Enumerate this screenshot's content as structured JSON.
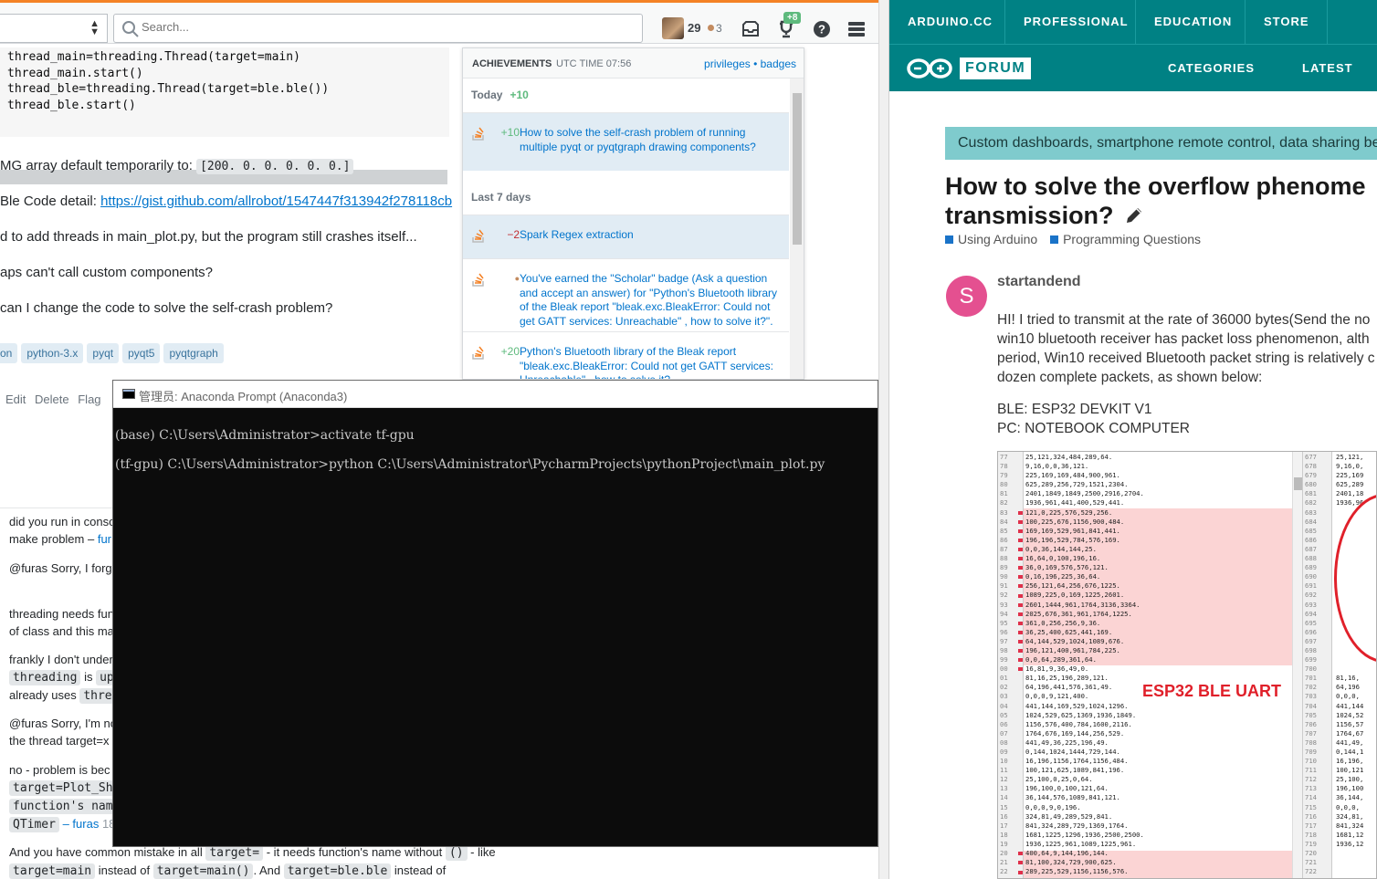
{
  "so": {
    "search_placeholder": "Search...",
    "reputation": "29",
    "bronze_count": "3",
    "achievements_badge": "+8",
    "code_lines": "thread_main=threading.Thread(target=main)\nthread_main.start()\nthread_ble=threading.Thread(target=ble.ble())\nthread_ble.start()",
    "question": {
      "line1_text": "MG array default temporarily to: ",
      "line1_code": "[200.    0.    0.    0.    0.    0.]",
      "line2_text": " Ble Code detail: ",
      "line2_link": "https://gist.github.com/allrobot/1547447f313942f278118cb",
      "line3": "d to add threads in main_plot.py, but the program still crashes itself...",
      "line4": "aps can't call custom components?",
      "line5": "can I change the code to solve the self-crash problem?"
    },
    "tags": [
      "on",
      "python-3.x",
      "pyqt",
      "pyqt5",
      "pyqtgraph"
    ],
    "post_menu": [
      "Edit",
      "Delete",
      "Flag"
    ],
    "achievements": {
      "title": "ACHIEVEMENTS",
      "utc": "UTC TIME 07:56",
      "link_privileges": "privileges",
      "link_sep": " • ",
      "link_badges": "badges",
      "today_label": "Today",
      "today_total": "+10",
      "last7_label": "Last 7 days",
      "items": [
        {
          "delta": "+10",
          "text": "How to solve the self-crash problem of running multiple pyqt or pyqtgraph drawing components?"
        },
        {
          "delta": "−2",
          "text": "Spark Regex extraction"
        },
        {
          "delta": "●",
          "text": "You've earned the \"Scholar\" badge (Ask a question and accept an answer) for \"Python's Bluetooth library of the Bleak report \"bleak.exc.BleakError: Could not get GATT services: Unreachable\" , how to solve it?\"."
        },
        {
          "delta": "+20",
          "text": "Python's Bluetooth library of the Bleak report \"bleak.exc.BleakError: Could not get GATT services: Unreachable\" , how to solve it?"
        }
      ]
    },
    "comments": {
      "c1a": "did you run in conso",
      "c1b": "make problem – ",
      "c1b_user": "fur",
      "c2": "@furas Sorry, I forg",
      "c3a": "threading needs fun",
      "c3b": "of class and this ma",
      "c4a": "frankly I don't under",
      "c4b_code": "threading",
      "c4b_text": " is ",
      "c4b_code2": "up",
      "c4c_text": "already uses ",
      "c4c_code": "threa",
      "c5a": "@furas Sorry, I'm no",
      "c5b": "the thread target=x",
      "c6a": "no - problem is bec",
      "c6b_code": "target=Plot_Sh",
      "c6c_code": "function's nam",
      "c6d_code": "QTimer",
      "c6d_user": " – furas",
      "c6d_time": " 18",
      "bottom_1": "And you have common mistake in all ",
      "bottom_code1": "target=",
      "bottom_2": " - it needs function's name without ",
      "bottom_code2": "()",
      "bottom_3": " - like",
      "bottom_code3": "target=main",
      "bottom_4": " instead of ",
      "bottom_code4": "target=main()",
      "bottom_5": ". And ",
      "bottom_code5": "target=ble.ble",
      "bottom_6": " instead of"
    }
  },
  "console": {
    "title": "管理员: Anaconda Prompt (Anaconda3)",
    "lines": "(base) C:\\Users\\Administrator>activate tf-gpu\n(tf-gpu) C:\\Users\\Administrator>python C:\\Users\\Administrator\\PycharmProjects\\pythonProject\\main_plot.py"
  },
  "arduino": {
    "nav1": [
      "ARDUINO.CC",
      "PROFESSIONAL",
      "EDUCATION",
      "STORE"
    ],
    "forum_label": "FORUM",
    "nav2": [
      "CATEGORIES",
      "LATEST"
    ],
    "banner": "Custom dashboards, smartphone remote control, data sharing be",
    "title_line1": "How to solve the overflow phenome",
    "title_line2": "transmission?",
    "edit_icon": "pencil-icon",
    "category1": "Using Arduino",
    "category2": "Programming Questions",
    "author_initial": "S",
    "author": "startandend",
    "body": [
      "HI! I tried to transmit at the rate of 36000 bytes(Send the no",
      "win10 bluetooth receiver has packet loss phenomenon, alth",
      "period, Win10 received Bluetooth packet string is relatively c",
      "dozen complete packets, as shown below:"
    ],
    "spec1": "BLE: ESP32 DEVKIT V1",
    "spec2": "PC: NOTEBOOK COMPUTER",
    "image_label": "ESP32 BLE UART",
    "left_line_numbers": "77\n78\n79\n80\n81\n82\n83\n84\n85\n86\n87\n88\n89\n90\n91\n92\n93\n94\n95\n96\n97\n98\n99\n00\n01\n02\n03\n04\n05\n06\n07\n08\n09\n10\n11\n12\n13\n14\n15\n16\n17\n18\n19\n20\n21\n22",
    "left_text": "25,121,324,484,289,64.\n9,16,0,0,36,121.\n225,169,169,484,900,961.\n625,289,256,729,1521,2304.\n2401,1849,1849,2500,2916,2704.\n1936,961,441,400,529,441.\n121,0,225,576,529,256.\n100,225,676,1156,900,484.\n169,169,529,961,841,441.\n196,196,529,784,576,169.\n0,0,36,144,144,25.\n16,64,0,100,196,16.\n36,0,169,576,576,121.\n0,16,196,225,36,64.\n256,121,64,256,676,1225.\n1089,225,0,169,1225,2601.\n2601,1444,961,1764,3136,3364.\n2025,676,361,961,1764,1225.\n361,0,256,256,9,36.\n36,25,400,625,441,169.\n64,144,529,1024,1089,676.\n196,121,400,961,784,225.\n0,0,64,289,361,64.\n16,81,9,36,49,0.\n81,16,25,196,289,121.\n64,196,441,576,361,49.\n0,0,0,9,121,400.\n441,144,169,529,1024,1296.\n1024,529,625,1369,1936,1849.\n1156,576,400,784,1600,2116.\n1764,676,169,144,256,529.\n441,49,36,225,196,49.\n0,144,1024,1444,729,144.\n16,196,1156,1764,1156,484.\n100,121,625,1089,841,196.\n25,100,0,25,0,64.\n196,100,0,100,121,64.\n36,144,576,1089,841,121.\n0,0,0,9,0,196.\n324,81,49,289,529,841.\n841,324,289,729,1369,1764.\n1681,1225,1296,1936,2500,2500.\n1936,1225,961,1089,1225,961.\n400,64,9,144,196,144.\n81,100,324,729,900,625.\n289,225,529,1156,1156,576.",
    "right_line_numbers": "677\n678\n679\n680\n681\n682\n683\n684\n685\n686\n687\n688\n689\n690\n691\n692\n693\n694\n695\n696\n697\n698\n699\n700\n701\n702\n703\n704\n705\n706\n707\n708\n709\n710\n711\n712\n713\n714\n715\n716\n717\n718\n719\n720\n721\n722",
    "right_text": "25,121,\n9,16,0,\n225,169\n625,289\n2401,18\n1936,96\n\n\n\n\n\n\n\n\n\n\n\n\n\n\n\n\n\n\n81,16,\n64,196\n0,0,0,\n441,144\n1024,52\n1156,57\n1764,67\n441,49,\n0,144,1\n16,196,\n100,121\n25,100,\n196,100\n36,144,\n0,0,0,\n324,81,\n841,324\n1681,12\n1936,12\n\n\n"
  }
}
